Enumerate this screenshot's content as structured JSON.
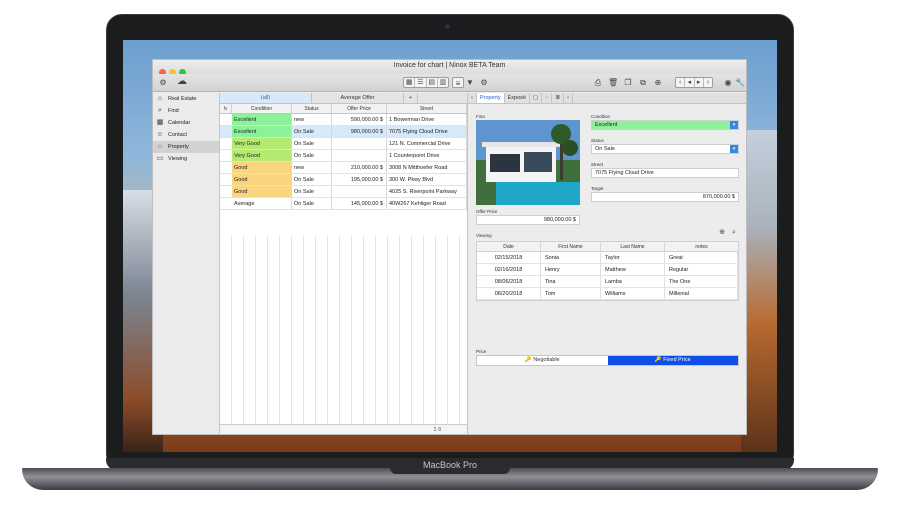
{
  "device": {
    "brand": "MacBook Pro"
  },
  "window": {
    "title": "Invoice for chart | Ninox BETA Team"
  },
  "toolbar": {
    "left_icons": [
      "settings-icon",
      "cloud-icon"
    ],
    "right_icons": [
      "copy-icon",
      "trash-icon",
      "duplicate-icon",
      "print-icon",
      "list-icon",
      "add-icon",
      "filter-icon",
      "gear-icon",
      "nav-arrows",
      "person-icon",
      "wrench-icon"
    ]
  },
  "sidebar": {
    "items": [
      {
        "label": "Real Estate",
        "icon": "house-icon"
      },
      {
        "label": "Find",
        "icon": "search-icon"
      },
      {
        "label": "Calendar",
        "icon": "calendar-icon"
      },
      {
        "label": "Contact",
        "icon": "contact-icon"
      },
      {
        "label": "Property",
        "icon": "house-icon",
        "active": true
      },
      {
        "label": "Viewing",
        "icon": "viewing-icon"
      }
    ]
  },
  "list": {
    "tabs": [
      "(all)",
      "Average Offer",
      "+"
    ],
    "columns": [
      "Condition",
      "Status",
      "Offer Price",
      "Street"
    ],
    "rows": [
      {
        "condition": "Excellent",
        "status": "new",
        "offer": "590,000.00 $",
        "street": "1 Bowerman Drive",
        "color": "#8cf299"
      },
      {
        "condition": "Excellent",
        "status": "On Sale",
        "offer": "980,000.00 $",
        "street": "7075 Flying Cloud Drive",
        "color": "#8cf299",
        "selected": true
      },
      {
        "condition": "Very Good",
        "status": "On Sale",
        "offer": "",
        "street": "121 N. Commercial Drive",
        "color": "#b4ea70"
      },
      {
        "condition": "Very Good",
        "status": "On Sale",
        "offer": "",
        "street": "1 Counterpoint Drive",
        "color": "#b4ea70"
      },
      {
        "condition": "Good",
        "status": "new",
        "offer": "210,000.00 $",
        "street": "3008 N Mitthoefer Road",
        "color": "#fad57f"
      },
      {
        "condition": "Good",
        "status": "On Sale",
        "offer": "195,000.00 $",
        "street": "300 W. Pkwy Blvd",
        "color": "#fad57f"
      },
      {
        "condition": "Good",
        "status": "On Sale",
        "offer": "",
        "street": "4025 S. Riverpoint Parkway",
        "color": "#fad57f"
      },
      {
        "condition": "Average",
        "status": "On Sale",
        "offer": "145,000.00 $",
        "street": "40W267 Kehliger Road",
        "color": "#ffffff"
      }
    ],
    "footer": "Σ 8"
  },
  "detail": {
    "tabs": [
      "Property",
      "Exposé"
    ],
    "foto_label": "Foto",
    "condition_label": "Condition",
    "condition_value": "Excellent",
    "status_label": "Status",
    "status_value": "On Sale",
    "street_label": "Street",
    "street_value": "7075 Flying Cloud Drive",
    "target_label": "Target",
    "target_value": "870,000.00 $",
    "offer_label": "Offer Price",
    "offer_value": "980,000.00 $",
    "viewing_label": "Viewing",
    "viewing_columns": [
      "Date",
      "First Name",
      "Last Name",
      "notes"
    ],
    "viewings": [
      {
        "date": "02/15/2018",
        "first": "Sonia",
        "last": "Taylor",
        "notes": "Great"
      },
      {
        "date": "02/16/2018",
        "first": "Henry",
        "last": "Matthew",
        "notes": "Regular"
      },
      {
        "date": "08/06/2018",
        "first": "Tina",
        "last": "Lamba",
        "notes": "The One"
      },
      {
        "date": "08/20/2018",
        "first": "Tom",
        "last": "Williams",
        "notes": "Millenial"
      }
    ],
    "price_label": "Price",
    "price_options": [
      "Negotiable",
      "Fixed Price"
    ]
  }
}
